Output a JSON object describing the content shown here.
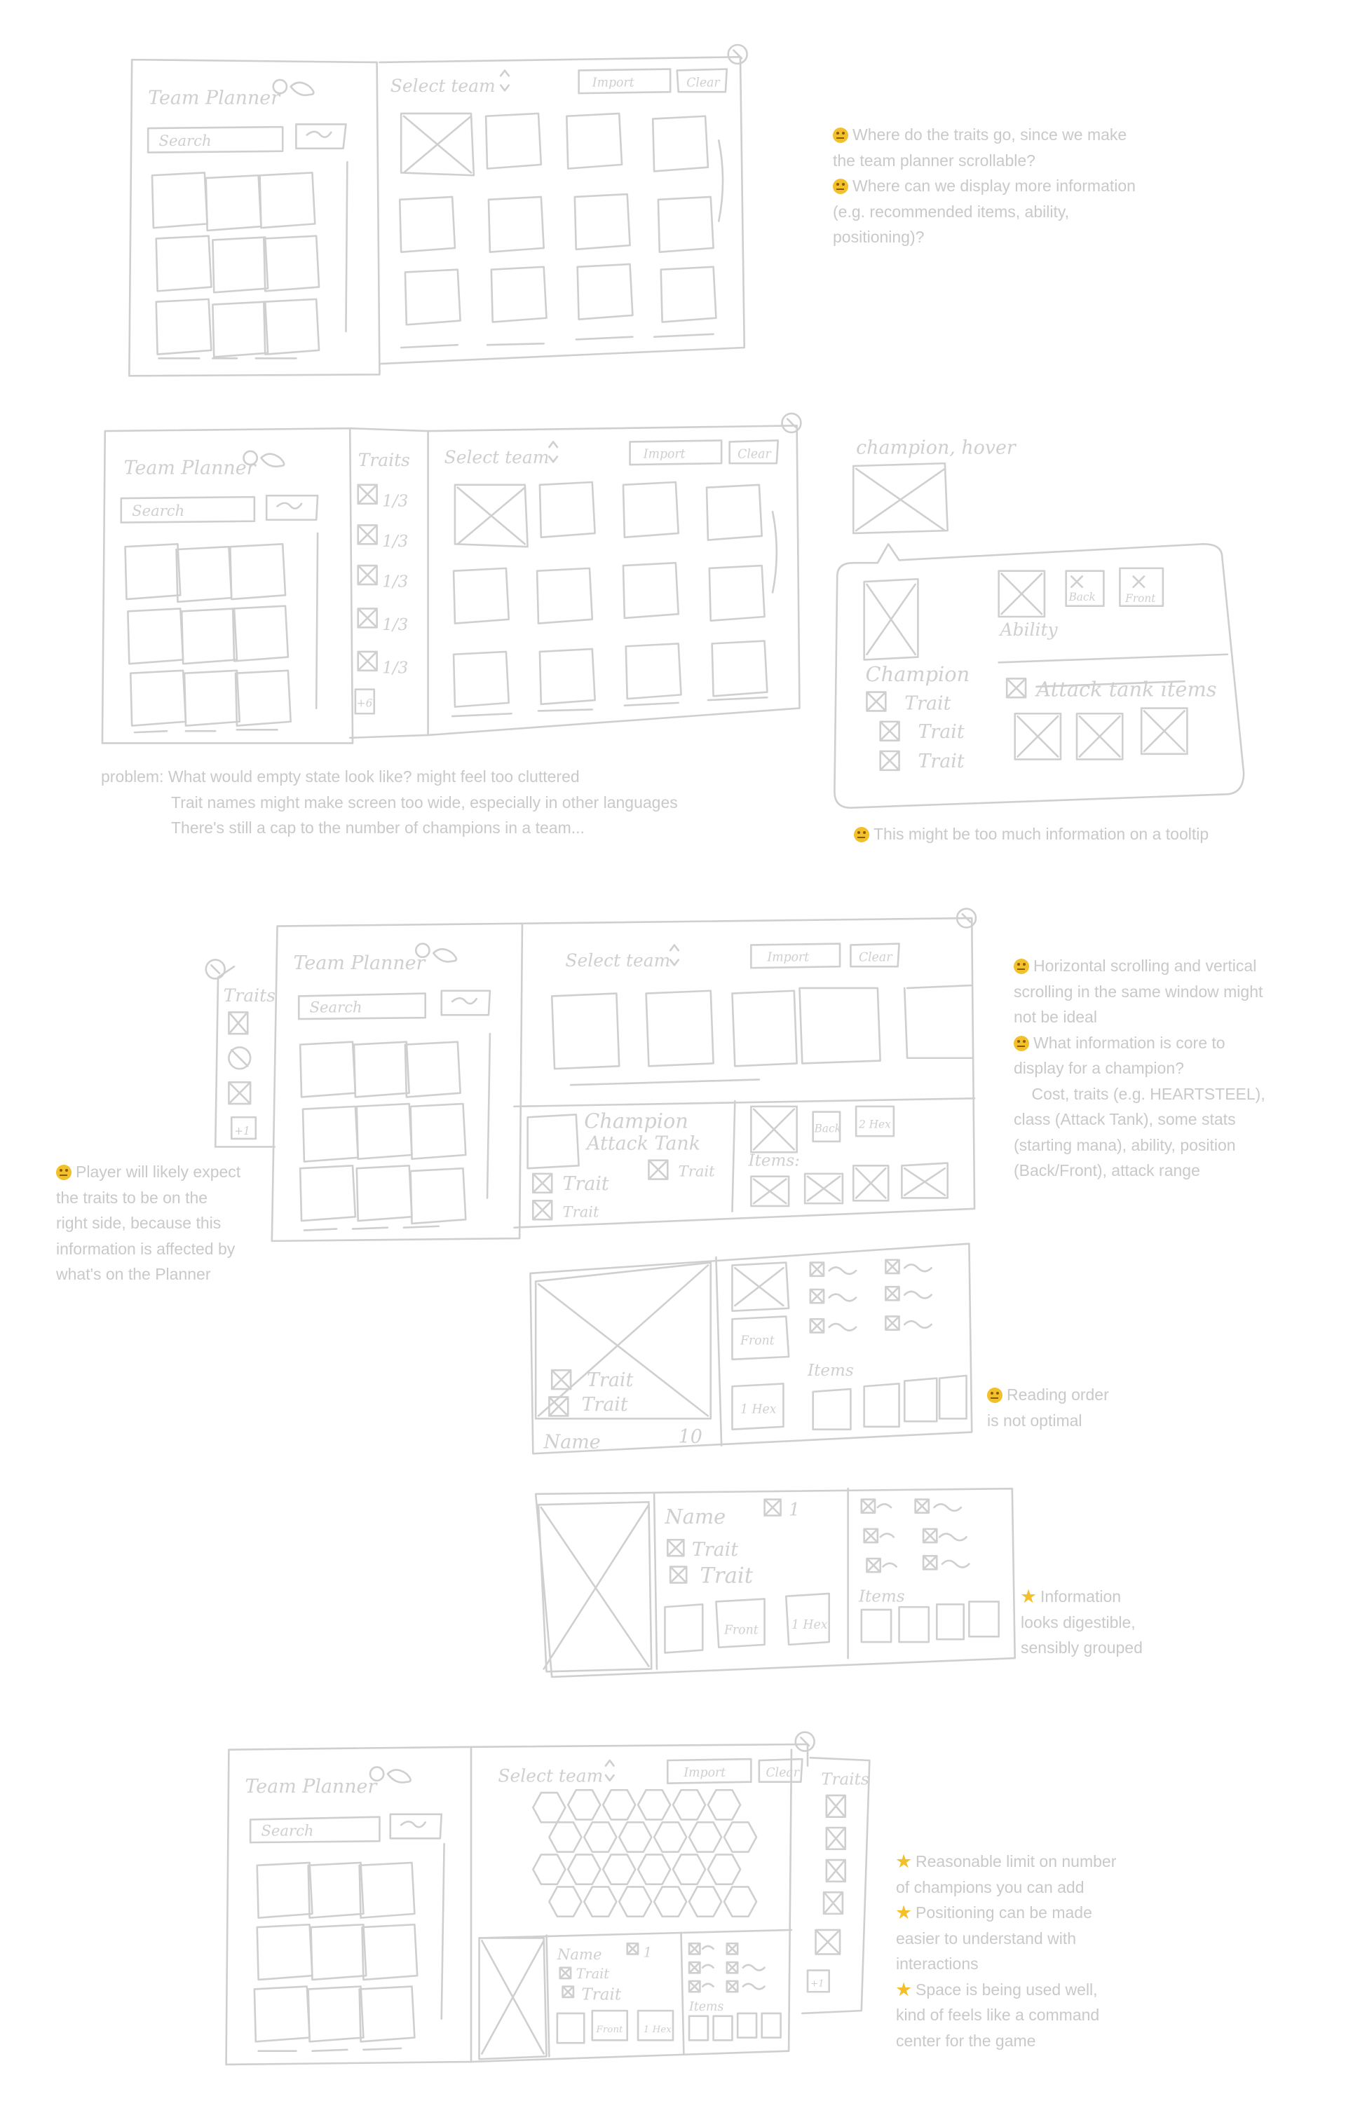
{
  "colors": {
    "sketch_stroke": "#cfcfcf",
    "note_text": "#c9c9c9",
    "emoji_yellow": "#f2c02a"
  },
  "sketch_labels": {
    "team_planner": "Team Planner",
    "search": "Search",
    "select_team": "Select team",
    "import": "Import",
    "clear": "Clear",
    "traits": "Traits",
    "trait_count": "1/3",
    "trait_more": "+6",
    "more": "+1",
    "champion_hover": "champion, hover",
    "back": "Back",
    "front": "Front",
    "ability": "Ability",
    "champion": "Champion",
    "champion_attack_tank": "Champion",
    "attack_tank": "Attack Tank",
    "trait": "Trait",
    "items": "Items:",
    "attack_tank_items": "Attack tank items",
    "items_label": "Items",
    "range": "2 Hex",
    "range_short": "1 Hex",
    "name": "Name",
    "name_cost": "1",
    "name_cost_alt": "10"
  },
  "notes": {
    "n1": [
      {
        "icon": "thinking-face",
        "text": "Where do the traits go, since we make"
      },
      {
        "icon": "",
        "text": "the team planner scrollable?"
      },
      {
        "icon": "thinking-face",
        "text": "Where can we display more information"
      },
      {
        "icon": "",
        "text": "(e.g. recommended items, ability,"
      },
      {
        "icon": "",
        "text": "positioning)?"
      }
    ],
    "n2_problem": [
      {
        "text": "problem: What would empty state look like? might feel too cluttered"
      },
      {
        "text": "Trait names might make screen too wide, especially in other languages"
      },
      {
        "text": "There's still a cap to the number of champions in a team..."
      }
    ],
    "n3_tooltip": "This might be too much information on a tooltip",
    "n4": [
      {
        "icon": "thinking-face",
        "text": "Horizontal scrolling and vertical"
      },
      {
        "icon": "",
        "text": "scrolling in the same window might"
      },
      {
        "icon": "",
        "text": "not be ideal"
      },
      {
        "icon": "thinking-face",
        "text": "What information is core to"
      },
      {
        "icon": "",
        "text": "display for a champion?"
      },
      {
        "icon": "",
        "text": "    Cost, traits (e.g. HEARTSTEEL),"
      },
      {
        "icon": "",
        "text": "class (Attack Tank), some stats"
      },
      {
        "icon": "",
        "text": "(starting mana), ability, position"
      },
      {
        "icon": "",
        "text": "(Back/Front), attack range"
      }
    ],
    "n5": [
      {
        "icon": "thinking-face",
        "text": "Player will likely expect"
      },
      {
        "icon": "",
        "text": "the traits to be on the"
      },
      {
        "icon": "",
        "text": "right side, because this"
      },
      {
        "icon": "",
        "text": "information is affected by"
      },
      {
        "icon": "",
        "text": "what's on the Planner"
      }
    ],
    "n6": [
      {
        "icon": "thinking-face",
        "text": "Reading order"
      },
      {
        "icon": "",
        "text": "is not optimal"
      }
    ],
    "n7": [
      {
        "icon": "star",
        "text": "Information"
      },
      {
        "icon": "",
        "text": "looks digestible,"
      },
      {
        "icon": "",
        "text": "sensibly grouped"
      }
    ],
    "n8": [
      {
        "icon": "star",
        "text": "Reasonable limit on number"
      },
      {
        "icon": "",
        "text": "of champions you can add"
      },
      {
        "icon": "star",
        "text": "Positioning can be made"
      },
      {
        "icon": "",
        "text": "easier to understand with"
      },
      {
        "icon": "",
        "text": "interactions"
      },
      {
        "icon": "star",
        "text": "Space is being used well,"
      },
      {
        "icon": "",
        "text": "kind of feels like a command"
      },
      {
        "icon": "",
        "text": "center for the game"
      }
    ]
  }
}
